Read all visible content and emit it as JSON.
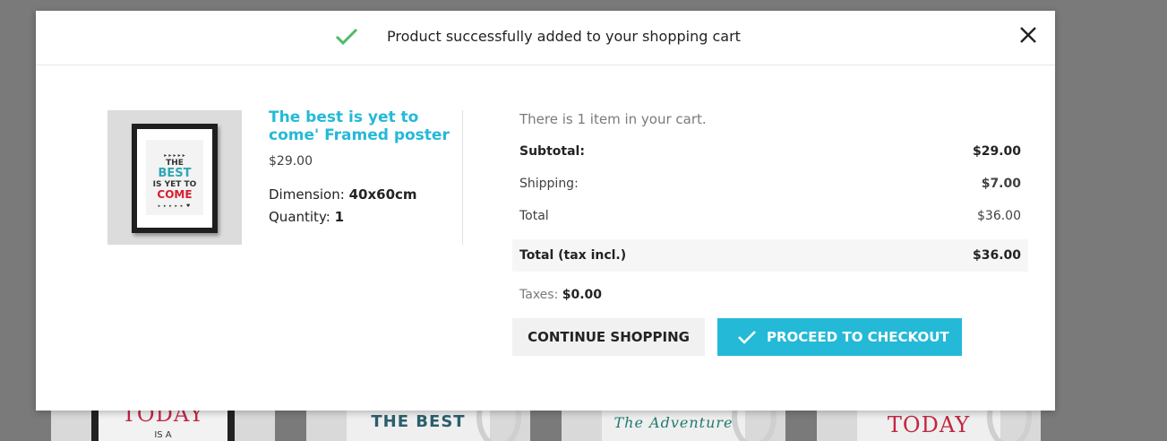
{
  "background": {
    "tiles": [
      {
        "text": "TODAY",
        "sub": "IS A",
        "color": "#c22742",
        "frame": true
      },
      {
        "text": "THE BEST",
        "sub": "",
        "color": "#2a5f6e",
        "frame": false
      },
      {
        "text": "The Adventure",
        "sub": "",
        "color": "#1f7a6e",
        "frame": false
      },
      {
        "text": "TODAY",
        "sub": "",
        "color": "#c22742",
        "frame": false
      }
    ]
  },
  "modal": {
    "header": {
      "message": "Product successfully added to your shopping cart",
      "check_icon": "check-icon",
      "close_icon": "close-icon",
      "check_color": "#4cbb6c"
    },
    "product": {
      "name": "The best is yet to come' Framed poster",
      "price": "$29.00",
      "dimension_label": "Dimension:",
      "dimension_value": "40x60cm",
      "quantity_label": "Quantity:",
      "quantity_value": "1",
      "image_text": {
        "line1": "▸ ▸ ▸ ▸ ▸",
        "line2": "THE",
        "line3": "BEST",
        "line4": "IS YET TO",
        "line5": "COME",
        "line6": "▸ ▸ ▸ ▸ ▸ ♥"
      }
    },
    "cart": {
      "count_text": "There is 1 item in your cart.",
      "subtotal_label": "Subtotal:",
      "subtotal_value": "$29.00",
      "shipping_label": "Shipping:",
      "shipping_value": "$7.00",
      "total_label": "Total",
      "total_value": "$36.00",
      "total_tax_label": "Total (tax incl.)",
      "total_tax_value": "$36.00",
      "taxes_label": "Taxes:",
      "taxes_value": "$0.00"
    },
    "buttons": {
      "continue_label": "CONTINUE SHOPPING",
      "checkout_label": "PROCEED TO CHECKOUT",
      "accent": "#24b9d7"
    }
  }
}
